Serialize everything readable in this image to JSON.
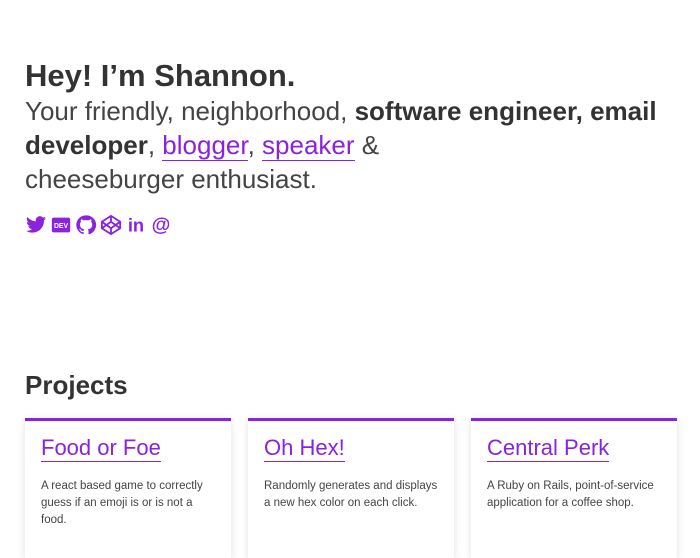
{
  "hero": {
    "heading": "Hey! I’m Shannon.",
    "intro": "Your friendly, neighborhood, ",
    "roles_bold": "software engineer, email developer",
    "sep1": ", ",
    "link_blogger": "blogger",
    "sep2": ", ",
    "link_speaker": "speaker",
    "amp": " & ",
    "ending": "cheeseburger enthusiast."
  },
  "social": [
    {
      "icon": "twitter-icon"
    },
    {
      "icon": "dev-icon",
      "text": "DEV"
    },
    {
      "icon": "github-icon"
    },
    {
      "icon": "codepen-icon"
    },
    {
      "icon": "linkedin-icon",
      "text": "in"
    },
    {
      "icon": "email-icon",
      "text": "@"
    }
  ],
  "projects": {
    "title": "Projects",
    "items": [
      {
        "title": "Food or Foe",
        "description": "A react based game to correctly guess if an emoji is or is not a food."
      },
      {
        "title": "Oh Hex!",
        "description": "Randomly generates and displays a new hex color on each click."
      },
      {
        "title": "Central Perk",
        "description": "A Ruby on Rails, point-of-service application for a coffee shop."
      }
    ]
  },
  "colors": {
    "accent": "#8a22e0",
    "text": "#333333"
  }
}
